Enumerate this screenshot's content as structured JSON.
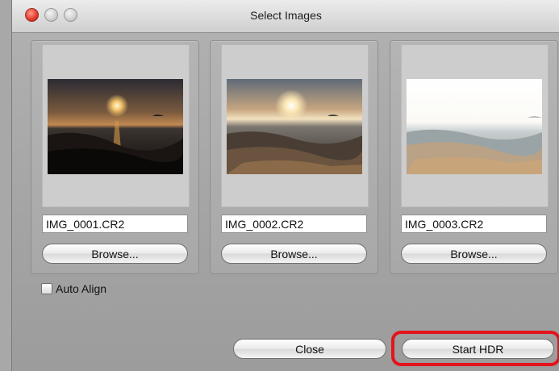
{
  "window": {
    "title": "Select Images"
  },
  "images": [
    {
      "filename": "IMG_0001.CR2",
      "browse_label": "Browse..."
    },
    {
      "filename": "IMG_0002.CR2",
      "browse_label": "Browse..."
    },
    {
      "filename": "IMG_0003.CR2",
      "browse_label": "Browse..."
    }
  ],
  "auto_align": {
    "label": "Auto Align",
    "checked": false
  },
  "buttons": {
    "close": "Close",
    "start_hdr": "Start HDR"
  },
  "colors": {
    "highlight": "#e3141c",
    "window_bg": "#a8a8a8"
  }
}
